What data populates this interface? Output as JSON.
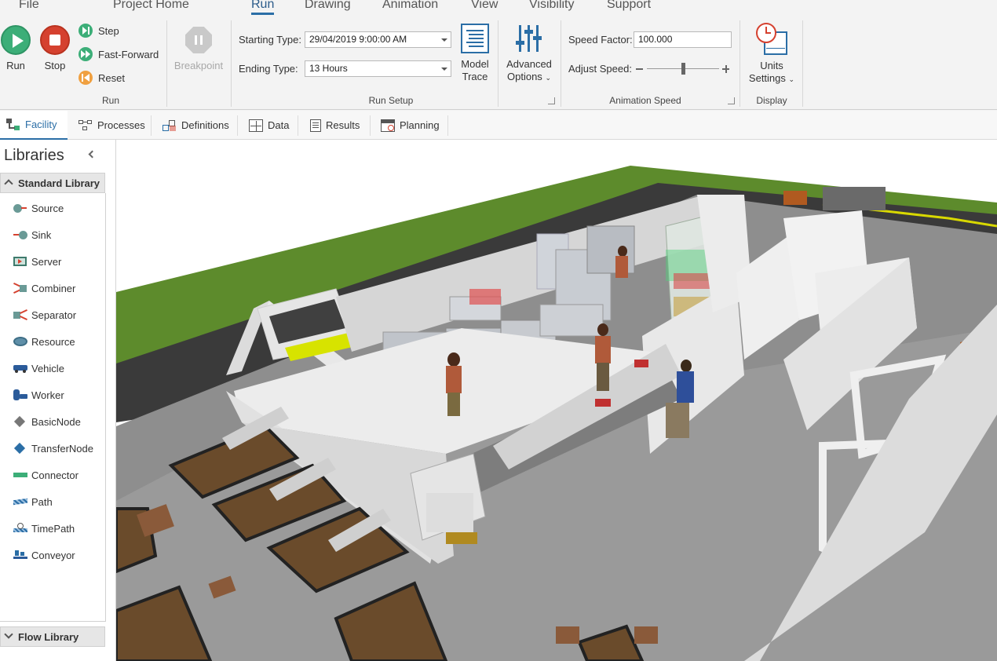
{
  "menu": {
    "items": [
      "File",
      "Project Home",
      "Run",
      "Drawing",
      "Animation",
      "View",
      "Visibility",
      "Support"
    ],
    "active": "Run"
  },
  "ribbon": {
    "run_group": {
      "run_label": "Run",
      "stop_label": "Stop",
      "step_label": "Step",
      "fast_forward_label": "Fast-Forward",
      "reset_label": "Reset",
      "group_label": "Run"
    },
    "breakpoint_label": "Breakpoint",
    "run_setup": {
      "starting_type_label": "Starting Type:",
      "starting_type_value": "29/04/2019 9:00:00 AM",
      "ending_type_label": "Ending Type:",
      "ending_type_value": "13 Hours",
      "model_trace_label_1": "Model",
      "model_trace_label_2": "Trace",
      "advanced_options_label_1": "Advanced",
      "advanced_options_label_2": "Options",
      "group_label": "Run Setup"
    },
    "animation_speed": {
      "speed_factor_label": "Speed Factor:",
      "speed_factor_value": "100.000",
      "adjust_speed_label": "Adjust Speed:",
      "slider_level": 0.5,
      "group_label": "Animation Speed"
    },
    "display": {
      "units_label_1": "Units",
      "units_label_2": "Settings",
      "group_label": "Display"
    }
  },
  "tabs": [
    "Facility",
    "Processes",
    "Definitions",
    "Data",
    "Results",
    "Planning"
  ],
  "active_tab": "Facility",
  "libraries": {
    "title": "Libraries",
    "standard_header": "Standard Library",
    "items": [
      "Source",
      "Sink",
      "Server",
      "Combiner",
      "Separator",
      "Resource",
      "Vehicle",
      "Worker",
      "BasicNode",
      "TransferNode",
      "Connector",
      "Path",
      "TimePath",
      "Conveyor"
    ],
    "flow_header": "Flow Library"
  },
  "colors": {
    "accent": "#2b6ea6",
    "run_green": "#3cae78",
    "stop_red": "#d5412f",
    "reset_orange": "#f0a040",
    "grass": "#5d8b2c",
    "road": "#3a3a3a",
    "floor": "#8c8c8c"
  }
}
